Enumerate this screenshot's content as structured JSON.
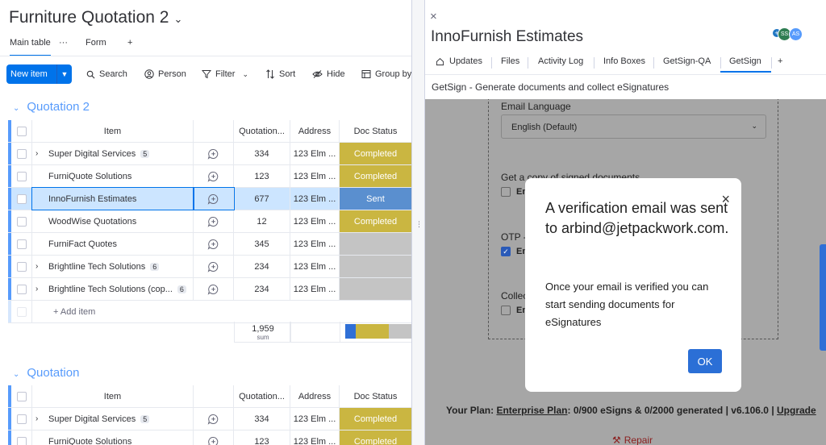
{
  "board": {
    "title": "Furniture Quotation 2",
    "views": {
      "main": "Main table",
      "more": "···",
      "form": "Form",
      "add": "+"
    },
    "toolbar": {
      "new_item": "New item",
      "search": "Search",
      "person": "Person",
      "filter": "Filter",
      "sort": "Sort",
      "hide": "Hide",
      "group_by": "Group by"
    },
    "columns": {
      "item": "Item",
      "quotation": "Quotation...",
      "address": "Address",
      "status": "Doc Status"
    },
    "groups": [
      {
        "name": "Quotation 2",
        "rows": [
          {
            "name": "Super Digital Services",
            "subitems": "5",
            "quotation": "334",
            "address": "123 Elm ...",
            "status": "Completed"
          },
          {
            "name": "FurniQuote Solutions",
            "subitems": "",
            "quotation": "123",
            "address": "123 Elm ...",
            "status": "Completed"
          },
          {
            "name": "InnoFurnish Estimates",
            "subitems": "",
            "quotation": "677",
            "address": "123 Elm ...",
            "status": "Sent"
          },
          {
            "name": "WoodWise Quotations",
            "subitems": "",
            "quotation": "12",
            "address": "123 Elm ...",
            "status": "Completed"
          },
          {
            "name": "FurniFact Quotes",
            "subitems": "",
            "quotation": "345",
            "address": "123 Elm ...",
            "status": ""
          },
          {
            "name": "Brightline Tech Solutions",
            "subitems": "6",
            "quotation": "234",
            "address": "123 Elm ...",
            "status": ""
          },
          {
            "name": "Brightline Tech Solutions (cop...",
            "subitems": "6",
            "quotation": "234",
            "address": "123 Elm ...",
            "status": ""
          }
        ],
        "add_item": "+ Add item",
        "sum_value": "1,959",
        "sum_label": "sum"
      },
      {
        "name": "Quotation",
        "rows": [
          {
            "name": "Super Digital Services",
            "subitems": "5",
            "quotation": "334",
            "address": "123 Elm ...",
            "status": "Completed"
          },
          {
            "name": "FurniQuote Solutions",
            "subitems": "",
            "quotation": "123",
            "address": "123 Elm ...",
            "status": "Completed"
          }
        ]
      }
    ]
  },
  "panel": {
    "close": "×",
    "title": "InnoFurnish Estimates",
    "avatars": [
      "+",
      "SS",
      "AS"
    ],
    "tabs": [
      "Updates",
      "Files",
      "Activity Log",
      "Info Boxes",
      "GetSign-QA",
      "GetSign",
      "+"
    ],
    "app_title": "GetSign - Generate documents and collect eSignatures",
    "form": {
      "email_language_label": "Email Language",
      "email_language_value": "English (Default)",
      "copy_label": "Get a copy of signed documents",
      "otp_label": "OTP -",
      "collect_label": "Collect",
      "checkbox_text": "En"
    },
    "plan": {
      "prefix": "Your Plan: ",
      "plan_name": "Enterprise Plan",
      "usage": ": 0/900 eSigns & 0/2000 generated | v6.106.0 | ",
      "upgrade": "Upgrade"
    },
    "repair": "Repair"
  },
  "modal": {
    "title": "A verification email was sent to arbind@jetpackwork.com.",
    "body": "Once your email is verified you can start sending documents for eSignatures",
    "ok": "OK",
    "close": "×"
  },
  "colors": {
    "primary": "#0073ea",
    "completed": "#cab641",
    "sent": "#5a8fcf",
    "empty": "#c4c4c4",
    "group": "#579bfc",
    "overlay": "#a6a6a6"
  }
}
